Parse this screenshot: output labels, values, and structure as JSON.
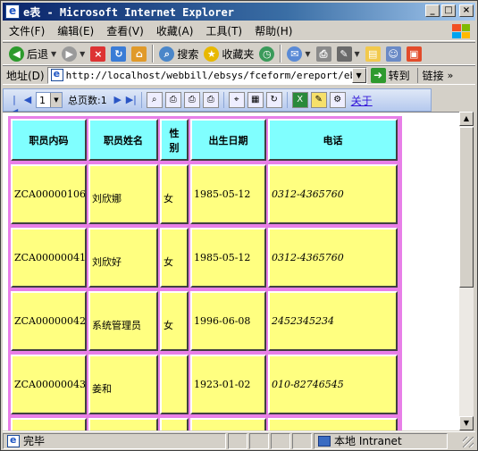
{
  "window": {
    "title": "e表 - Microsoft Internet Explorer"
  },
  "menu": [
    "文件(F)",
    "编辑(E)",
    "查看(V)",
    "收藏(A)",
    "工具(T)",
    "帮助(H)"
  ],
  "toolbar": {
    "back": "后退",
    "search": "搜索",
    "favorites": "收藏夹"
  },
  "address": {
    "label": "地址(D)",
    "url": "http://localhost/webbill/ebsys/fceform/ereport/ebrun.htm",
    "go": "转到",
    "links": "链接"
  },
  "report_toolbar": {
    "current_page": "1",
    "total_pages": "总页数:1",
    "about": "关于"
  },
  "table": {
    "headers": [
      "职员内码",
      "职员姓名",
      "性别",
      "出生日期",
      "电话"
    ],
    "rows": [
      [
        "ZCA00000106",
        "刘欣娜",
        "女",
        "1985-05-12",
        "0312-4365760"
      ],
      [
        "ZCA00000041",
        "刘欣好",
        "女",
        "1985-05-12",
        "0312-4365760"
      ],
      [
        "ZCA00000042",
        "系统管理员",
        "女",
        "1996-06-08",
        "2452345234"
      ],
      [
        "ZCA00000043",
        "姜和",
        "",
        "1923-01-02",
        "010-82746545"
      ]
    ]
  },
  "status": {
    "text": "完毕",
    "zone": "本地 Intranet"
  },
  "colors": {
    "header_cell": "#80ffff",
    "data_cell": "#ffff80",
    "grid_background": "#e87fe8"
  }
}
